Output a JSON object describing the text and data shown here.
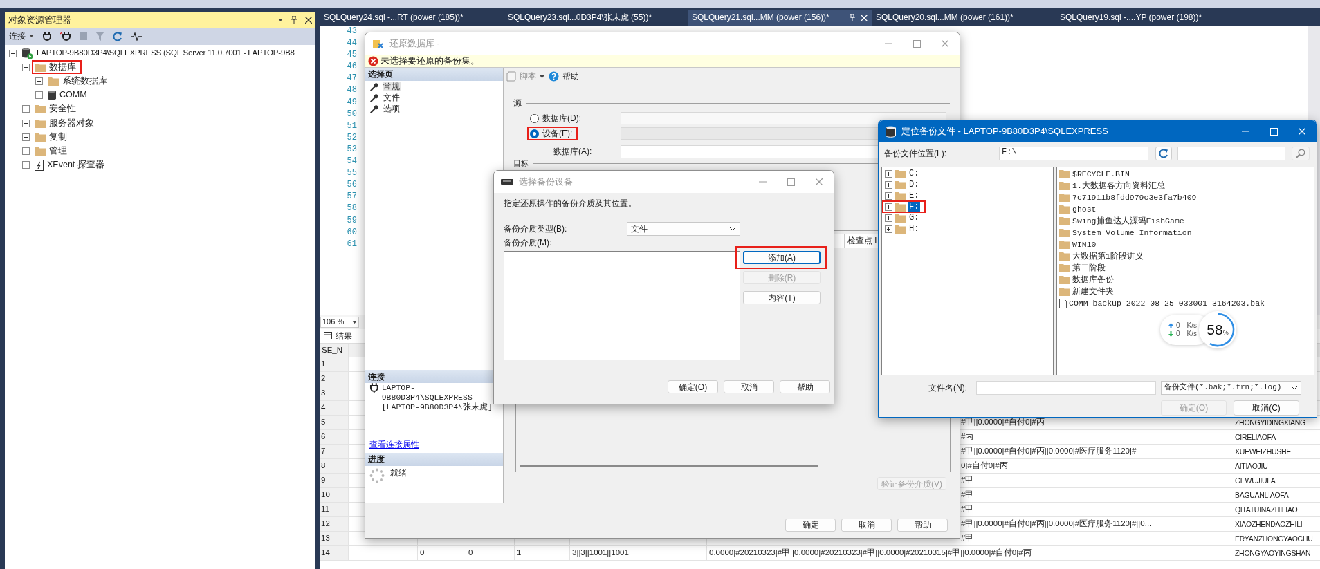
{
  "app": {
    "object_explorer": {
      "title": "对象资源管理器",
      "connect_label": "连接",
      "tree": [
        {
          "label": "LAPTOP-9B80D3P4\\SQLEXPRESS (SQL Server 11.0.7001 - LAPTOP-9B8",
          "kind": "server",
          "expanded": true,
          "highlighted": false,
          "children": [
            {
              "label": "数据库",
              "kind": "folder",
              "expanded": true,
              "highlighted": true,
              "children": [
                {
                  "label": "系统数据库",
                  "kind": "folder",
                  "expanded": false,
                  "highlighted": false
                },
                {
                  "label": "COMM",
                  "kind": "database",
                  "expanded": false,
                  "highlighted": false
                }
              ]
            },
            {
              "label": "安全性",
              "kind": "folder",
              "expanded": false,
              "highlighted": false
            },
            {
              "label": "服务器对象",
              "kind": "folder",
              "expanded": false,
              "highlighted": false
            },
            {
              "label": "复制",
              "kind": "folder",
              "expanded": false,
              "highlighted": false
            },
            {
              "label": "管理",
              "kind": "folder",
              "expanded": false,
              "highlighted": false
            },
            {
              "label": "XEvent 探查器",
              "kind": "xevent",
              "expanded": false,
              "highlighted": false
            }
          ]
        }
      ]
    },
    "editor": {
      "tabs": [
        {
          "label": "SQLQuery24.sql -...RT (power (185))*",
          "selected": false
        },
        {
          "label": "SQLQuery23.sql...0D3P4\\张末虎 (55))*",
          "selected": false
        },
        {
          "label": "SQLQuery21.sql...MM (power (156))*",
          "selected": true
        },
        {
          "label": "SQLQuery20.sql...MM (power (161))*",
          "selected": false
        },
        {
          "label": "SQLQuery19.sql -....YP (power (198))*",
          "selected": false
        }
      ],
      "line_numbers": [
        "43",
        "44",
        "45",
        "46",
        "47",
        "48",
        "49",
        "50",
        "51",
        "52",
        "53",
        "54",
        "55",
        "56",
        "57",
        "58",
        "59",
        "60",
        "61"
      ],
      "zoom": "106 %"
    },
    "results": {
      "tab": "结果",
      "header": "SE_N",
      "rows": [
        {
          "number": "1"
        },
        {
          "number": "2"
        },
        {
          "number": "3"
        },
        {
          "number": "4"
        },
        {
          "number": "5",
          "col_6": "#甲||0.0000|#自付0|#丙",
          "col_8": "ZHONGYIDINGXIANG"
        },
        {
          "number": "6",
          "col_6": "#丙",
          "col_8": "CIRELIAOFA"
        },
        {
          "number": "7",
          "col_6": "#甲||0.0000|#自付0|#丙||0.0000|#医疗服务1120|#",
          "col_8": "XUEWEIZHUSHE"
        },
        {
          "number": "8",
          "col_6": "0|#自付0|#丙",
          "col_8": "AITIAOJIU"
        },
        {
          "number": "9",
          "col_6": "#甲",
          "col_8": "GEWUJIUFA"
        },
        {
          "number": "10",
          "col_6": "#甲",
          "col_8": "BAGUANLIAOFA"
        },
        {
          "number": "11",
          "col_6": "#甲",
          "col_8": "QITATUINAZHILIAO"
        },
        {
          "number": "12",
          "col_6": "#甲||0.0000|#自付0|#丙||0.0000|#医疗服务1120|#||0...",
          "col_8": "XIAOZHENDAOZHILI"
        },
        {
          "number": "13",
          "col_6": "#甲",
          "col_8": "ERYANZHONGYAOCHU"
        },
        {
          "number": "14",
          "col_2": "0",
          "col_3": "0",
          "col_4": "1",
          "col_5": "3||3||1001||1001",
          "col_6": "0.0000|#20210323|#甲||0.0000|#20210323|#甲||0.0000|#20210315|#甲||0.0000|#自付0|#丙",
          "col_8": "ZHONGYAOYINGSHAN"
        }
      ]
    }
  },
  "restore_dialog": {
    "title": "还原数据库 -",
    "message": "未选择要还原的备份集。",
    "pages_header": "选择页",
    "pages": [
      {
        "label": "常规",
        "selected": true
      },
      {
        "label": "文件",
        "selected": false
      },
      {
        "label": "选项",
        "selected": false
      }
    ],
    "toolbar": [
      {
        "label": "脚本",
        "kind": "script"
      },
      {
        "label": "帮助",
        "kind": "help"
      }
    ],
    "source_label": "源",
    "source_options": [
      {
        "label": "数据库(D):",
        "selected": false,
        "highlighted": false
      },
      {
        "label": "设备(E):",
        "selected": true,
        "highlighted": true
      }
    ],
    "database_label": "数据库(A):",
    "destination_label": "目标",
    "grid_header": "检查点 L",
    "verify_button": "验证备份介质(V)",
    "connection_header": "连接",
    "connection_lines": [
      "LAPTOP-9B80D3P4\\SQLEXPRESS",
      "[LAPTOP-9B80D3P4\\张末虎]"
    ],
    "connection_link": "查看连接属性",
    "progress_header": "进度",
    "progress_status": "就绪",
    "buttons": [
      {
        "label": "确定",
        "disabled": false
      },
      {
        "label": "取消",
        "disabled": false
      },
      {
        "label": "帮助",
        "disabled": false
      }
    ]
  },
  "device_dialog": {
    "title": "选择备份设备",
    "instruction": "指定还原操作的备份介质及其位置。",
    "media_type_label": "备份介质类型(B):",
    "media_type": "文件",
    "media_label": "备份介质(M):",
    "side_buttons": [
      {
        "label": "添加(A)",
        "disabled": false,
        "highlighted": true,
        "focused": true
      },
      {
        "label": "删除(R)",
        "disabled": true,
        "highlighted": false,
        "focused": false
      },
      {
        "label": "内容(T)",
        "disabled": false,
        "highlighted": false,
        "focused": false
      }
    ],
    "buttons": [
      {
        "label": "确定(O)",
        "disabled": false
      },
      {
        "label": "取消",
        "disabled": false
      },
      {
        "label": "帮助",
        "disabled": false
      }
    ]
  },
  "locate_dialog": {
    "title": "定位备份文件 - LAPTOP-9B80D3P4\\SQLEXPRESS",
    "location_label": "备份文件位置(L):",
    "location": "F:\\",
    "drives": [
      {
        "label": "C:",
        "selected": false,
        "highlighted": false
      },
      {
        "label": "D:",
        "selected": false,
        "highlighted": false
      },
      {
        "label": "E:",
        "selected": false,
        "highlighted": false
      },
      {
        "label": "F:",
        "selected": true,
        "highlighted": true
      },
      {
        "label": "G:",
        "selected": false,
        "highlighted": false
      },
      {
        "label": "H:",
        "selected": false,
        "highlighted": false
      }
    ],
    "files": [
      {
        "label": "$RECYCLE.BIN",
        "kind": "folder"
      },
      {
        "label": "1.大数据各方向资料汇总",
        "kind": "folder"
      },
      {
        "label": "7c71911b8fdd979c3e3fa7b409",
        "kind": "folder"
      },
      {
        "label": "ghost",
        "kind": "folder"
      },
      {
        "label": "Swing捕鱼达人源码FishGame",
        "kind": "folder"
      },
      {
        "label": "System Volume Information",
        "kind": "folder"
      },
      {
        "label": "WIN10",
        "kind": "folder"
      },
      {
        "label": "大数据第1阶段讲义",
        "kind": "folder"
      },
      {
        "label": "第二阶段",
        "kind": "folder"
      },
      {
        "label": "数据库备份",
        "kind": "folder"
      },
      {
        "label": "新建文件夹",
        "kind": "folder"
      },
      {
        "label": "COMM_backup_2022_08_25_033001_3164203.bak",
        "kind": "file"
      }
    ],
    "filename_label": "文件名(N):",
    "filter": "备份文件(*.bak;*.trn;*.log)",
    "buttons": [
      {
        "label": "确定(O)",
        "disabled": true
      },
      {
        "label": "取消(C)",
        "disabled": false
      }
    ]
  },
  "speed_widget": {
    "rates": [
      {
        "kind": "up",
        "value": "0",
        "unit": "K/s"
      },
      {
        "kind": "down",
        "value": "0",
        "unit": "K/s"
      }
    ],
    "percent": "58",
    "percent_sign": "%",
    "level": 0.58
  }
}
